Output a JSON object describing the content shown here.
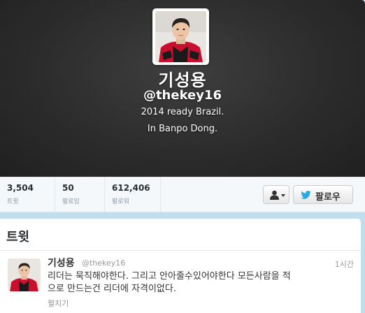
{
  "profile": {
    "display_name": "기성용",
    "screen_name": "@thekey16",
    "bio": "2014 ready Brazil.",
    "location": "In Banpo Dong."
  },
  "stats": [
    {
      "value": "3,504",
      "label": "트윗"
    },
    {
      "value": "50",
      "label": "팔로잉"
    },
    {
      "value": "612,406",
      "label": "팔로워"
    }
  ],
  "actions": {
    "follow_label": "팔로우"
  },
  "tweets_section": {
    "title": "트윗",
    "tweet": {
      "name": "기성용",
      "handle": "@thekey16",
      "time": "1시간",
      "line1": "리더는 묵직해야한다. 그리고 안아줄수있어야한다 모든사람을 적",
      "line2": "으로 만드는건 리더에 자격이없다.",
      "expand": "펼치기"
    }
  },
  "colors": {
    "header_bg": "#2c2c2c",
    "jacket_red": "#c8102e",
    "twitter_blue": "#2aa9e0"
  },
  "icons": [
    "person-icon",
    "chevron-down-icon",
    "twitter-bird-icon"
  ]
}
